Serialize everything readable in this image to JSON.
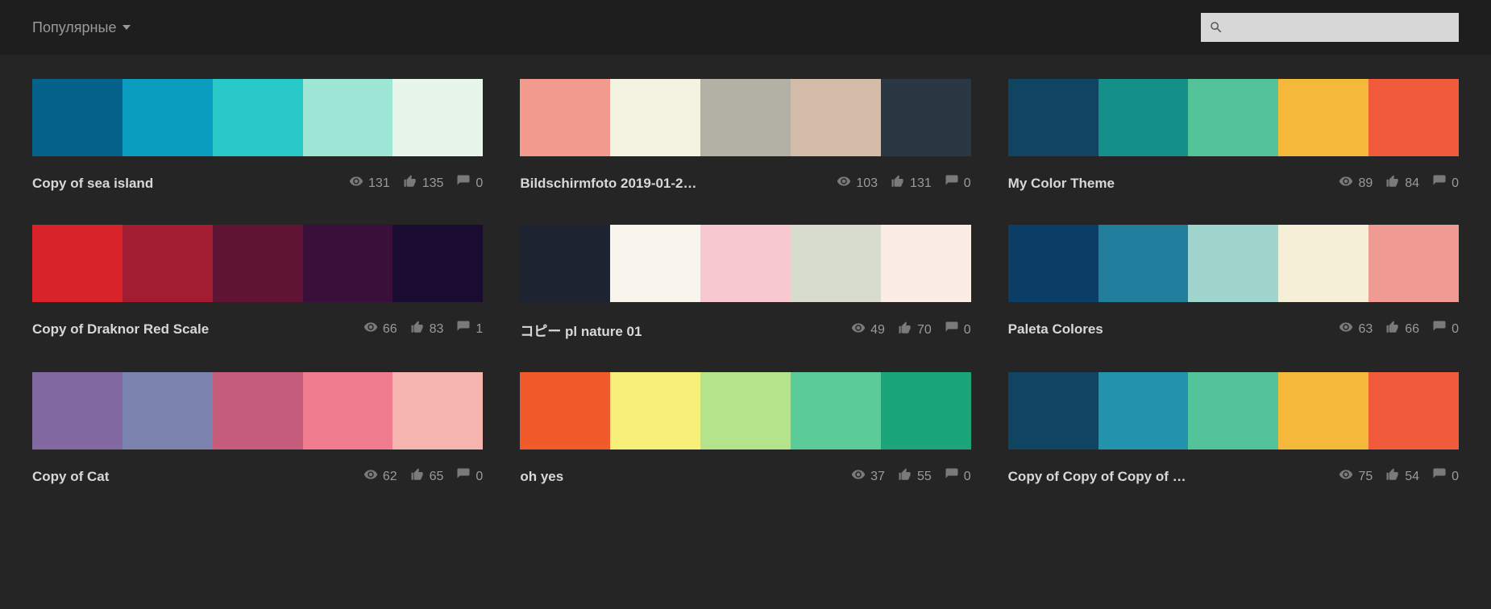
{
  "header": {
    "filter_label": "Популярные",
    "search_placeholder": ""
  },
  "themes": [
    {
      "title": "Copy of sea island",
      "colors": [
        "#06618b",
        "#0a9dbf",
        "#29c9c9",
        "#9ee6d6",
        "#e8f5ea"
      ],
      "views": 131,
      "likes": 135,
      "comments": 0
    },
    {
      "title": "Bildschirmfoto 2019-01-2…",
      "colors": [
        "#f29a8e",
        "#f2f3e1",
        "#b3b1a5",
        "#d2bca7",
        "#2b3742"
      ],
      "views": 103,
      "likes": 131,
      "comments": 0
    },
    {
      "title": "My Color Theme",
      "colors": [
        "#0f4462",
        "#148f89",
        "#53c39a",
        "#f4b83a",
        "#f15b3c"
      ],
      "views": 89,
      "likes": 84,
      "comments": 0
    },
    {
      "title": "Copy of Draknor Red Scale",
      "colors": [
        "#d8232a",
        "#a31d32",
        "#5e1432",
        "#3a103a",
        "#1a0c30"
      ],
      "views": 66,
      "likes": 83,
      "comments": 1
    },
    {
      "title": "コピー pl nature 01",
      "colors": [
        "#1d2330",
        "#faf5ec",
        "#f7c8cf",
        "#d7dcce",
        "#fbece6"
      ],
      "views": 49,
      "likes": 70,
      "comments": 0
    },
    {
      "title": "Paleta Colores",
      "colors": [
        "#0b3e66",
        "#217e9c",
        "#9fd5cd",
        "#f4efd6",
        "#f09a94"
      ],
      "views": 63,
      "likes": 66,
      "comments": 0
    },
    {
      "title": "Copy of Cat",
      "colors": [
        "#8369a1",
        "#7a82ad",
        "#c65c7c",
        "#f07d8d",
        "#f5b4ae"
      ],
      "views": 62,
      "likes": 65,
      "comments": 0
    },
    {
      "title": "oh yes",
      "colors": [
        "#f15a2b",
        "#f6f07a",
        "#b3e38b",
        "#5ccb9a",
        "#1ba67a"
      ],
      "views": 37,
      "likes": 55,
      "comments": 0
    },
    {
      "title": "Copy of Copy of Copy of …",
      "colors": [
        "#0f4462",
        "#2392ad",
        "#53c39a",
        "#f4b83a",
        "#f15b3c"
      ],
      "views": 75,
      "likes": 54,
      "comments": 0
    }
  ]
}
